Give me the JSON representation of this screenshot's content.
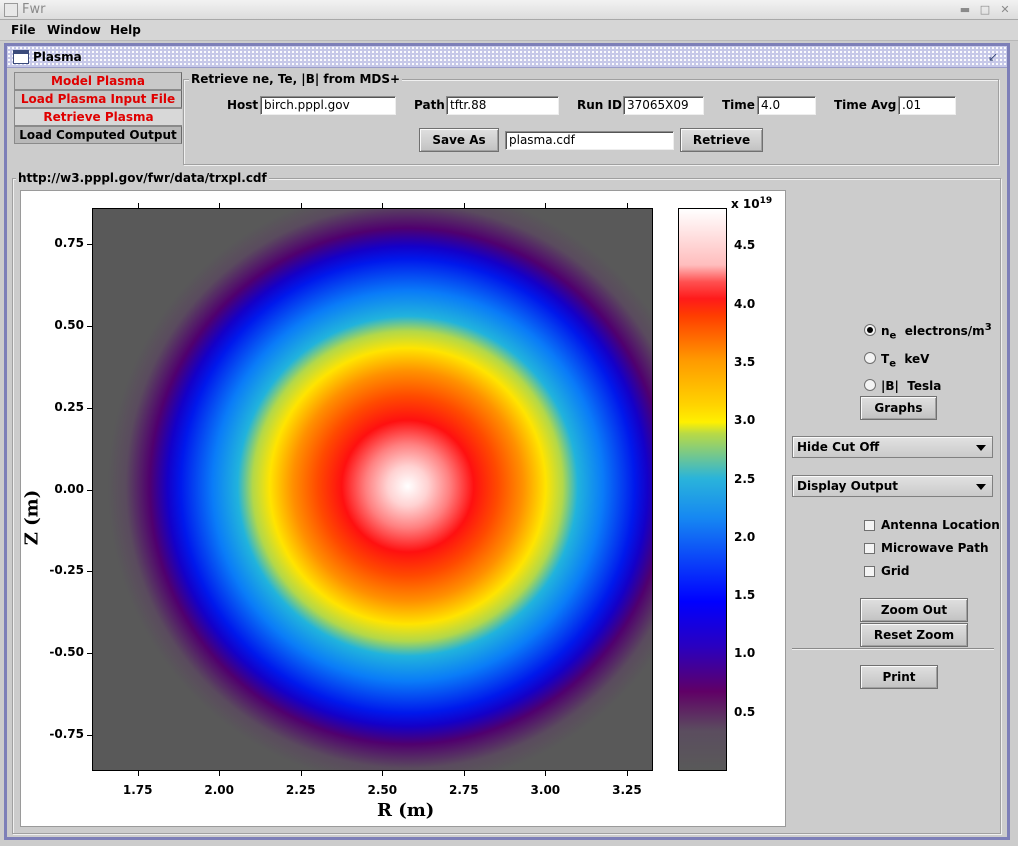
{
  "window": {
    "title": "Fwr"
  },
  "menu": [
    "File",
    "Window",
    "Help"
  ],
  "frame": {
    "title": "Plasma"
  },
  "tabs": [
    {
      "label": "Model Plasma",
      "selected": false,
      "color": "#e00000"
    },
    {
      "label": "Load Plasma Input File",
      "selected": false,
      "color": "#e00000"
    },
    {
      "label": "Retrieve Plasma",
      "selected": true,
      "color": "#e00000"
    },
    {
      "label": "Load Computed Output",
      "selected": false,
      "color": "#000000"
    }
  ],
  "retrieve": {
    "group_title": "Retrieve ne, Te, |B| from MDS+",
    "host_label": "Host",
    "host_value": "birch.pppl.gov",
    "path_label": "Path",
    "path_value": "tftr.88",
    "runid_label": "Run ID",
    "runid_value": "37065X09",
    "time_label": "Time",
    "time_value": "4.0",
    "timeavg_label": "Time Avg",
    "timeavg_value": ".01",
    "save_as_label": "Save As",
    "save_as_value": "plasma.cdf",
    "retrieve_label": "Retrieve"
  },
  "output": {
    "url": "http://w3.pppl.gov/fwr/data/trxpl.cdf"
  },
  "controls": {
    "radios": [
      {
        "main": "n",
        "sub": "e",
        "unit": "electrons/m",
        "sup": "3",
        "selected": true
      },
      {
        "main": "T",
        "sub": "e",
        "unit": "keV",
        "sup": "",
        "selected": false
      },
      {
        "main": "|B|",
        "sub": "",
        "unit": "Tesla",
        "sup": "",
        "selected": false
      }
    ],
    "graphs_label": "Graphs",
    "cutoff_select": "Hide Cut Off",
    "display_select": "Display Output",
    "checkboxes": [
      {
        "label": "Antenna Location",
        "checked": false
      },
      {
        "label": "Microwave Path",
        "checked": false
      },
      {
        "label": "Grid",
        "checked": false
      }
    ],
    "zoom_out_label": "Zoom Out",
    "reset_zoom_label": "Reset Zoom",
    "print_label": "Print"
  },
  "chart_data": {
    "type": "heatmap",
    "title": "",
    "xlabel": "R (m)",
    "ylabel": "Z (m)",
    "x_ticks": [
      "1.75",
      "2.00",
      "2.25",
      "2.50",
      "2.75",
      "3.00",
      "3.25"
    ],
    "y_ticks": [
      "0.75",
      "0.50",
      "0.25",
      "0.00",
      "-0.25",
      "-0.50",
      "-0.75"
    ],
    "xlim": [
      1.61,
      3.33
    ],
    "ylim": [
      -0.86,
      0.86
    ],
    "colorbar": {
      "scale_label": "x 10",
      "scale_exp": "19",
      "ticks": [
        "4.5",
        "4.0",
        "3.5",
        "3.0",
        "2.5",
        "2.0",
        "1.5",
        "1.0",
        "0.5"
      ],
      "range": [
        0.0,
        4.83
      ]
    },
    "peak": {
      "R": 2.58,
      "Z": 0.0,
      "value": 4.8
    },
    "boundary_radius_m": 0.88,
    "colormap": [
      "#595959",
      "#5a005e",
      "#0000ff",
      "#0b7ef7",
      "#2ab4da",
      "#fff000",
      "#ff8c00",
      "#ff1a1a",
      "#ffffff"
    ]
  }
}
